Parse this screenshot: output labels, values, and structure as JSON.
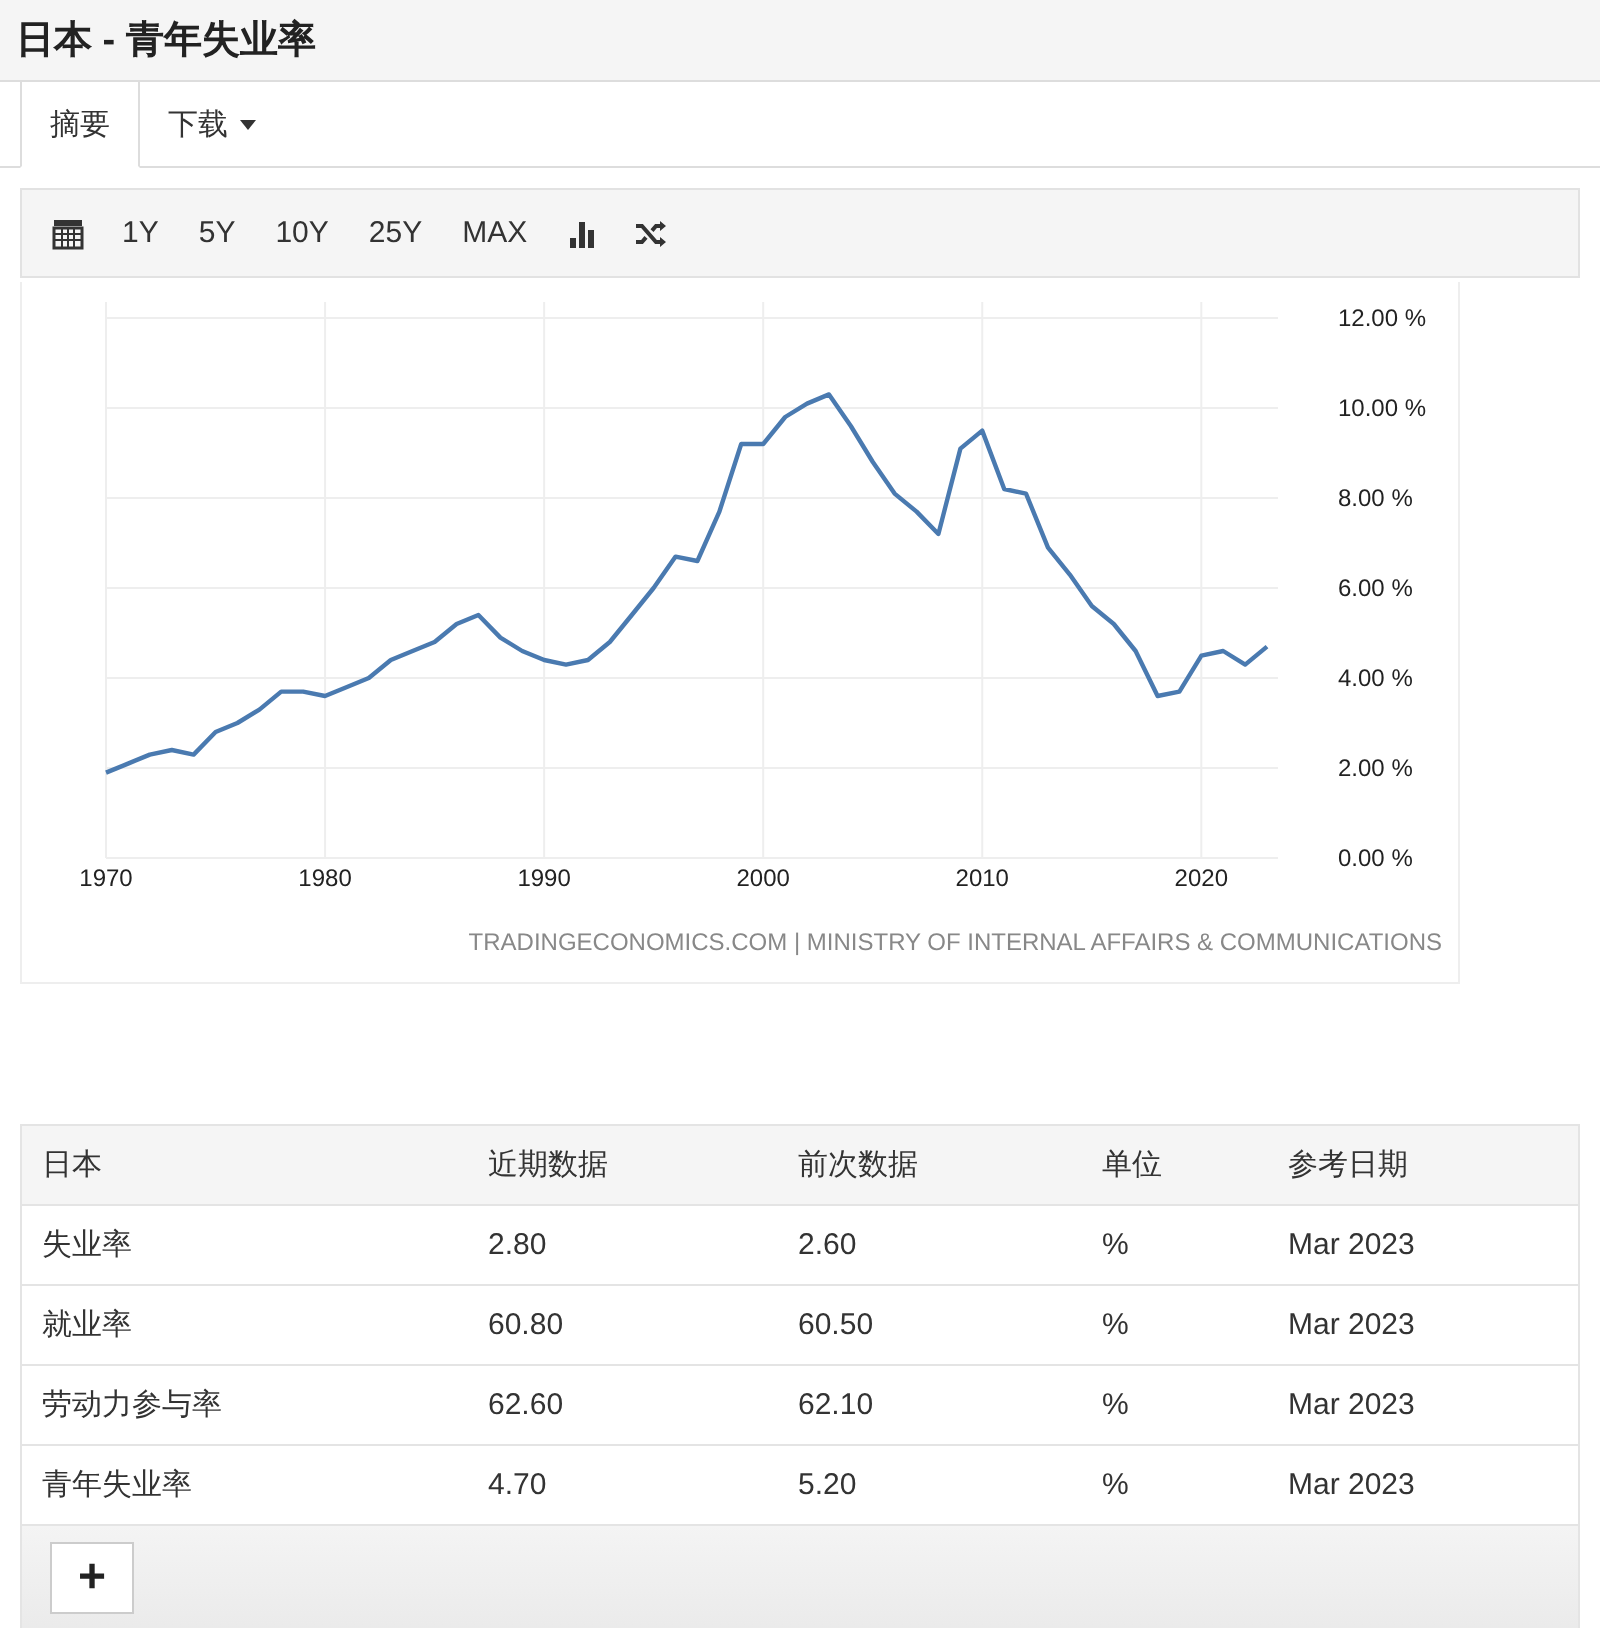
{
  "page_title": "日本 - 青年失业率",
  "tabs": [
    {
      "label": "摘要",
      "kind": "tab",
      "selected": true
    },
    {
      "label": "下载",
      "kind": "dropdown",
      "selected": false
    }
  ],
  "toolbar": {
    "ranges": [
      {
        "label": "1Y",
        "selected": false
      },
      {
        "label": "5Y",
        "selected": false
      },
      {
        "label": "10Y",
        "selected": false
      },
      {
        "label": "25Y",
        "selected": false
      },
      {
        "label": "MAX",
        "selected": false
      }
    ]
  },
  "chart": {
    "source": "TRADINGECONOMICS.COM | MINISTRY OF INTERNAL AFFAIRS & COMMUNICATIONS",
    "chart_data": {
      "type": "line",
      "x": [
        1970,
        1971,
        1972,
        1973,
        1974,
        1975,
        1976,
        1977,
        1978,
        1979,
        1980,
        1981,
        1982,
        1983,
        1984,
        1985,
        1986,
        1987,
        1988,
        1989,
        1990,
        1991,
        1992,
        1993,
        1994,
        1995,
        1996,
        1997,
        1998,
        1999,
        2000,
        2001,
        2002,
        2003,
        2004,
        2005,
        2006,
        2007,
        2008,
        2009,
        2010,
        2011,
        2012,
        2013,
        2014,
        2015,
        2016,
        2017,
        2018,
        2019,
        2020,
        2021,
        2022,
        2023
      ],
      "grid": true,
      "series": [
        {
          "color": "#4a7ab0",
          "values": [
            1.9,
            2.1,
            2.3,
            2.4,
            2.3,
            2.8,
            3.0,
            3.3,
            3.7,
            3.7,
            3.6,
            3.8,
            4.0,
            4.4,
            4.6,
            4.8,
            5.2,
            5.4,
            4.9,
            4.6,
            4.4,
            4.3,
            4.4,
            4.8,
            5.4,
            6.0,
            6.7,
            6.6,
            7.7,
            9.2,
            9.2,
            9.8,
            10.1,
            10.3,
            9.6,
            8.8,
            8.1,
            7.7,
            7.2,
            9.1,
            9.5,
            8.2,
            8.1,
            6.9,
            6.3,
            5.6,
            5.2,
            4.6,
            3.6,
            3.7,
            4.5,
            4.6,
            4.3,
            4.7
          ]
        }
      ],
      "xlim": [
        1970,
        2023.5
      ],
      "ylim": [
        0,
        12
      ],
      "xticks": [
        1970,
        1980,
        1990,
        2000,
        2010,
        2020
      ],
      "yticks": [
        {
          "value": 0,
          "label": "0.00 %"
        },
        {
          "value": 2,
          "label": "2.00 %"
        },
        {
          "value": 4,
          "label": "4.00 %"
        },
        {
          "value": 6,
          "label": "6.00 %"
        },
        {
          "value": 8,
          "label": "8.00 %"
        },
        {
          "value": 10,
          "label": "10.00 %"
        },
        {
          "value": 12,
          "label": "12.00 %"
        }
      ]
    }
  },
  "table": {
    "columns": [
      "日本",
      "近期数据",
      "前次数据",
      "单位",
      "参考日期"
    ],
    "rows": [
      [
        "失业率",
        "2.80",
        "2.60",
        "%",
        "Mar 2023"
      ],
      [
        "就业率",
        "60.80",
        "60.50",
        "%",
        "Mar 2023"
      ],
      [
        "劳动力参与率",
        "62.60",
        "62.10",
        "%",
        "Mar 2023"
      ],
      [
        "青年失业率",
        "4.70",
        "5.20",
        "%",
        "Mar 2023"
      ]
    ],
    "add_button": "+"
  }
}
